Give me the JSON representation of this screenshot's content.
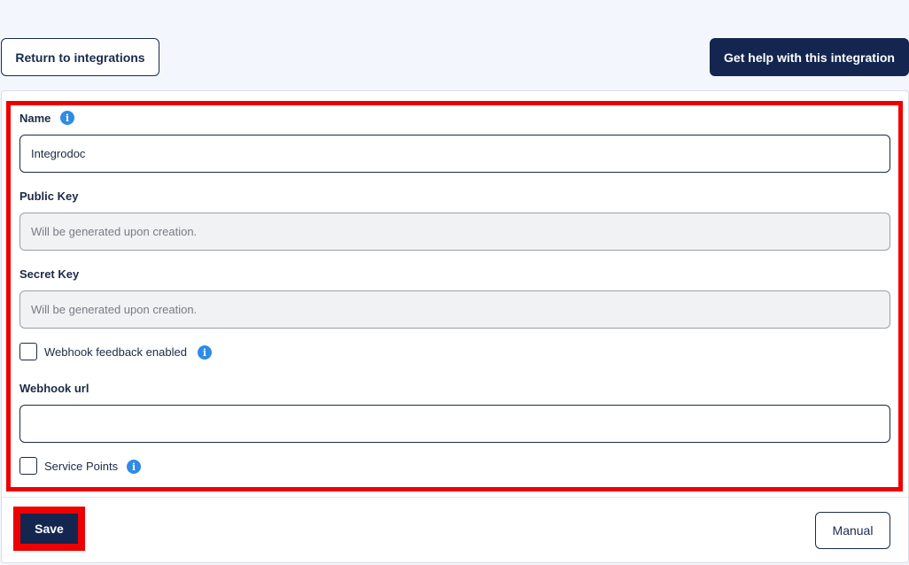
{
  "header": {
    "return_label": "Return to integrations",
    "help_label": "Get help with this integration"
  },
  "form": {
    "name": {
      "label": "Name",
      "value": "Integrodoc"
    },
    "public_key": {
      "label": "Public Key",
      "placeholder": "Will be generated upon creation."
    },
    "secret_key": {
      "label": "Secret Key",
      "placeholder": "Will be generated upon creation."
    },
    "webhook_feedback": {
      "label": "Webhook feedback enabled",
      "checked": false
    },
    "webhook_url": {
      "label": "Webhook url",
      "value": ""
    },
    "service_points": {
      "label": "Service Points",
      "checked": false
    }
  },
  "footer": {
    "save_label": "Save",
    "manual_label": "Manual"
  },
  "colors": {
    "primary": "#142650",
    "info": "#2e8be6",
    "highlight": "#ee0000",
    "background": "#f3f7fd"
  },
  "icons": {
    "info": "info-icon"
  }
}
